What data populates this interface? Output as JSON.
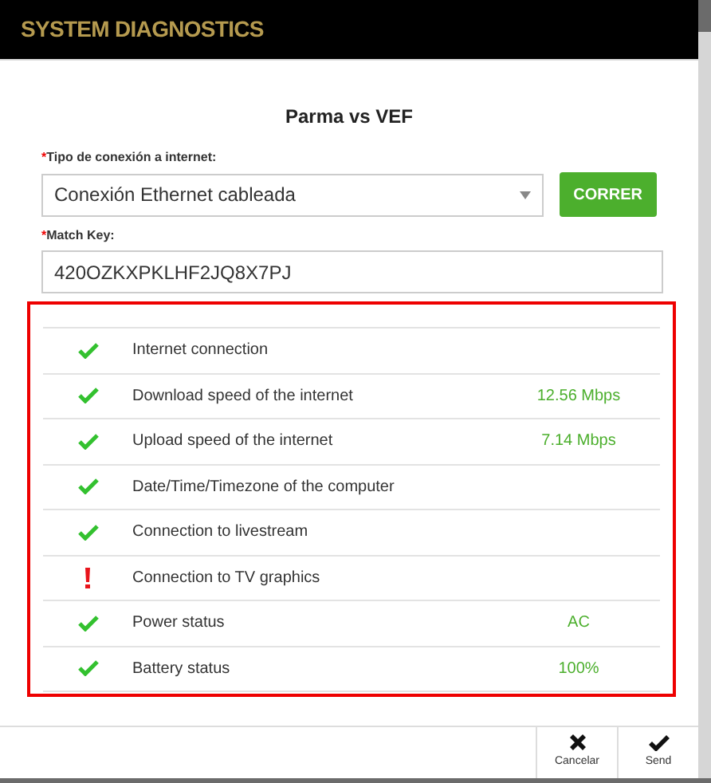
{
  "window": {
    "title": "SYSTEM DIAGNOSTICS"
  },
  "heading": "Parma vs VEF",
  "connection_type": {
    "required_mark": "*",
    "label": "Tipo de conexión a internet:",
    "value": "Conexión Ethernet cableada"
  },
  "run_button": "CORRER",
  "match_key": {
    "required_mark": "*",
    "label": "Match Key:",
    "value": "420OZKXPKLHF2JQ8X7PJ"
  },
  "checks": [
    {
      "kind": "ok",
      "label": "Internet connection"
    },
    {
      "kind": "ok",
      "label": "Download speed of the internet",
      "value": "12.56 Mbps"
    },
    {
      "kind": "ok",
      "label": "Upload speed of the internet",
      "value": "7.14 Mbps"
    },
    {
      "kind": "ok",
      "label": "Date/Time/Timezone of the computer"
    },
    {
      "kind": "ok",
      "label": "Connection to livestream"
    },
    {
      "kind": "warning",
      "label": "Connection to TV graphics"
    },
    {
      "kind": "ok",
      "label": "Power status",
      "value": "AC"
    },
    {
      "kind": "ok",
      "label": "Battery status",
      "value": "100%"
    }
  ],
  "footer_buttons": [
    {
      "kind": "cancel",
      "label": "Cancelar"
    },
    {
      "kind": "send",
      "label": "Send"
    }
  ]
}
